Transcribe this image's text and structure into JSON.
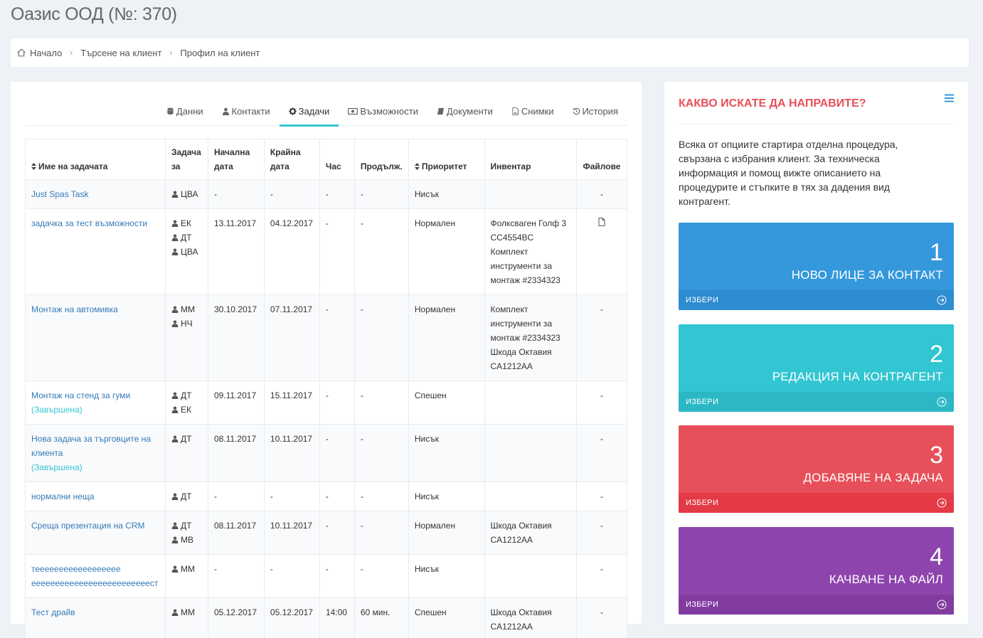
{
  "page": {
    "title": "Оазис ООД (№: 370)"
  },
  "breadcrumb": [
    "Начало",
    "Търсене на клиент",
    "Профил на клиент"
  ],
  "tabs": [
    {
      "label": "Данни",
      "icon": "database-icon"
    },
    {
      "label": "Контакти",
      "icon": "user-icon"
    },
    {
      "label": "Задачи",
      "icon": "gear-icon",
      "active": true
    },
    {
      "label": "Възможности",
      "icon": "money-icon"
    },
    {
      "label": "Документи",
      "icon": "book-icon"
    },
    {
      "label": "Снимки",
      "icon": "image-file-icon"
    },
    {
      "label": "История",
      "icon": "history-icon"
    }
  ],
  "table": {
    "headers": {
      "name": "Име на задачата",
      "assignee": "Задача за",
      "start": "Начална дата",
      "end": "Крайна дата",
      "time": "Час",
      "duration": "Продълж.",
      "priority": "Приоритет",
      "inventory": "Инвентар",
      "files": "Файлове"
    },
    "rows": [
      {
        "name": "Just Spas Task",
        "status": "",
        "assignees": [
          "ЦВА"
        ],
        "start": "-",
        "end": "-",
        "time": "-",
        "duration": "-",
        "priority": "Нисък",
        "inventory": [],
        "files": "-"
      },
      {
        "name": "задачка за тест възможности",
        "status": "",
        "assignees": [
          "ЕК",
          "ДТ",
          "ЦВА"
        ],
        "start": "13.11.2017",
        "end": "04.12.2017",
        "time": "-",
        "duration": "-",
        "priority": "Нормален",
        "inventory": [
          "Фолксваген Голф 3",
          "CC4554BC",
          "Комплект",
          "инструменти за",
          "монтаж #2334323"
        ],
        "files": "file-icon"
      },
      {
        "name": "Монтаж на автомивка",
        "status": "",
        "assignees": [
          "ММ",
          "НЧ"
        ],
        "start": "30.10.2017",
        "end": "07.11.2017",
        "time": "-",
        "duration": "-",
        "priority": "Нормален",
        "inventory": [
          "Комплект",
          "инструменти за",
          "монтаж #2334323",
          "Шкода Октавия",
          "CA1212AA"
        ],
        "files": "-"
      },
      {
        "name": "Монтаж на стенд за гуми",
        "status": "(Завършена)",
        "assignees": [
          "ДТ",
          "ЕК"
        ],
        "start": "09.11.2017",
        "end": "15.11.2017",
        "time": "-",
        "duration": "-",
        "priority": "Спешен",
        "inventory": [],
        "files": "-"
      },
      {
        "name": "Нова задача за търговците на клиента",
        "status": "(Завършена)",
        "assignees": [
          "ДТ"
        ],
        "start": "08.11.2017",
        "end": "10.11.2017",
        "time": "-",
        "duration": "-",
        "priority": "Нисък",
        "inventory": [],
        "files": "-"
      },
      {
        "name": "нормални неща",
        "status": "",
        "assignees": [
          "ДТ"
        ],
        "start": "-",
        "end": "-",
        "time": "-",
        "duration": "-",
        "priority": "Нисък",
        "inventory": [],
        "files": "-"
      },
      {
        "name": "Среща презентация на CRM",
        "status": "",
        "assignees": [
          "ДТ",
          "МВ"
        ],
        "start": "08.11.2017",
        "end": "10.11.2017",
        "time": "-",
        "duration": "-",
        "priority": "Нормален",
        "inventory": [
          "Шкода Октавия",
          "CA1212AA"
        ],
        "files": "-"
      },
      {
        "name": "тееееееееееееееееее ееееееееееееееееееееееееест",
        "status": "",
        "assignees": [
          "ММ"
        ],
        "start": "-",
        "end": "-",
        "time": "-",
        "duration": "-",
        "priority": "Нисък",
        "inventory": [],
        "files": "-"
      },
      {
        "name": "Тест драйв",
        "status": "",
        "assignees": [
          "ММ"
        ],
        "start": "05.12.2017",
        "end": "05.12.2017",
        "time": "14:00",
        "duration": "60 мин.",
        "priority": "Спешен",
        "inventory": [
          "Шкода Октавия",
          "CA1212AA"
        ],
        "files": "-"
      }
    ]
  },
  "actions": {
    "title": "КАКВО ИСКАТЕ ДА НАПРАВИТЕ?",
    "description": "Всяка от опциите стартира отделна процедура, свързана с избрания клиент. За техническа информация и помощ вижте описанието на процедурите и стъпките в тях за дадения вид контрагент.",
    "tiles": [
      {
        "number": "1",
        "label": "НОВО ЛИЦЕ ЗА КОНТАКТ",
        "select": "ИЗБЕРИ",
        "color": "#3598dc",
        "footer_color": "#2e8cd0"
      },
      {
        "number": "2",
        "label": "РЕДАКЦИЯ НА КОНТРАГЕНТ",
        "select": "ИЗБЕРИ",
        "color": "#32c5d2",
        "footer_color": "#2bb8c4"
      },
      {
        "number": "3",
        "label": "ДОБАВЯНЕ НА ЗАДАЧА",
        "select": "ИЗБЕРИ",
        "color": "#e7505a",
        "footer_color": "#e43a45"
      },
      {
        "number": "4",
        "label": "КАЧВАНЕ НА ФАЙЛ",
        "select": "ИЗБЕРИ",
        "color": "#8e44ad",
        "footer_color": "#823ca0"
      }
    ]
  }
}
